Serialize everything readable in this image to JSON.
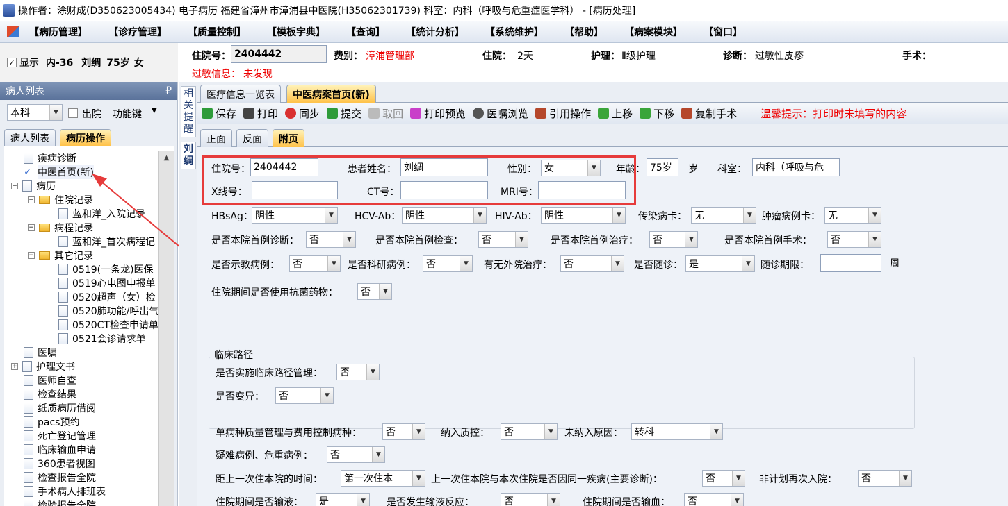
{
  "title": "操作者：涂财成(D350623005434) 电子病历  福建省漳州市漳浦县中医院(H35062301739)  科室：内科（呼吸与危重症医学科） - [病历处理]",
  "menu": [
    "【病历管理】",
    "【诊疗管理】",
    "【质量控制】",
    "【模板字典】",
    "【查询】",
    "【统计分析】",
    "【系统维护】",
    "【帮助】",
    "【病案模块】",
    "【窗口】"
  ],
  "left_info": {
    "show_label": "显示",
    "ward": "内-36",
    "name": "刘绸",
    "age": "75岁",
    "sex": "女"
  },
  "patient": {
    "zyh_label": "住院号：",
    "zyh": "2404442",
    "fb_label": "费别：",
    "fb": "漳浦管理部",
    "zy_label": "住院：",
    "zy": "2天",
    "hl_label": "护理：",
    "hl": "Ⅱ级护理",
    "zd_label": "诊断：",
    "zd": "过敏性皮疹",
    "ss_label": "手术：",
    "allergy_label": "过敏信息：",
    "allergy": "未发现"
  },
  "left_panel": {
    "header": "病人列表",
    "pin": "₽",
    "dept": "本科",
    "discharge": "出院",
    "func": "功能键",
    "tabs": [
      "病人列表",
      "病历操作"
    ],
    "tree": [
      {
        "label": "疾病诊断"
      },
      {
        "label": "中医首页(新)"
      },
      {
        "label": "病历"
      },
      {
        "label": "住院记录"
      },
      {
        "label": "蓝和洋_入院记录"
      },
      {
        "label": "病程记录"
      },
      {
        "label": "蓝和洋_首次病程记"
      },
      {
        "label": "其它记录"
      },
      {
        "label": "0519(一条龙)医保"
      },
      {
        "label": "0519心电图申报单"
      },
      {
        "label": "0520超声（女）检"
      },
      {
        "label": "0520肺功能/呼出气"
      },
      {
        "label": "0520CT检查申请单"
      },
      {
        "label": "0521会诊请求单"
      },
      {
        "label": "医嘱"
      },
      {
        "label": "护理文书"
      },
      {
        "label": "医师自查"
      },
      {
        "label": "检查结果"
      },
      {
        "label": "纸质病历借阅"
      },
      {
        "label": "pacs预约"
      },
      {
        "label": "死亡登记管理"
      },
      {
        "label": "临床输血申请"
      },
      {
        "label": "360患者视图"
      },
      {
        "label": "检查报告全院"
      },
      {
        "label": "手术病人排班表"
      },
      {
        "label": "检验报告全院"
      }
    ]
  },
  "side_strip": {
    "related": "相关提醒",
    "name": "刘绸"
  },
  "doc_tabs": [
    "医疗信息一览表",
    "中医病案首页(新)"
  ],
  "toolbar": {
    "items": [
      "保存",
      "打印",
      "同步",
      "提交",
      "取回",
      "打印预览",
      "医嘱浏览",
      "引用操作",
      "上移",
      "下移",
      "复制手术"
    ],
    "tip": "温馨提示：打印时未填写的内容"
  },
  "page_tabs": [
    "正面",
    "反面",
    "附页"
  ],
  "form": {
    "zyh_label": "住院号：",
    "zyh": "2404442",
    "name_label": "患者姓名：",
    "name": "刘绸",
    "sex_label": "性别：",
    "sex": "女",
    "age_label": "年龄：",
    "age": "75岁",
    "age_unit": "岁",
    "dept_label": "科室：",
    "dept": "内科（呼吸与危",
    "xray_label": "X线号：",
    "ct_label": "CT号：",
    "mri_label": "MRI号：",
    "hbsag_label": "HBsAg：",
    "hbsag": "阴性",
    "hcv_label": "HCV-Ab：",
    "hcv": "阴性",
    "hiv_label": "HIV-Ab：",
    "hiv": "阴性",
    "crb_label": "传染病卡：",
    "crb": "无",
    "zl_label": "肿瘤病例卡：",
    "zl": "无",
    "sczd_label": "是否本院首例诊断：",
    "sczd": "否",
    "scjc_label": "是否本院首例检查：",
    "scjc": "否",
    "sczl_label": "是否本院首例治疗：",
    "sczl": "否",
    "scss_label": "是否本院首例手术：",
    "scss": "否",
    "sj_label": "是否示教病例：",
    "sj": "否",
    "ky_label": "是否科研病例：",
    "ky": "否",
    "ywzl_label": "有无外院治疗：",
    "ywzl": "否",
    "sf_label": "是否随诊：",
    "sf": "是",
    "sfqx_label": "随诊期限：",
    "sfqx_unit": "周",
    "kjyw_label": "住院期间是否使用抗菌药物：",
    "kjyw": "否",
    "lclj_title": "临床路径",
    "lclj_label": "是否实施临床路径管理：",
    "lclj": "否",
    "by_label": "是否变异：",
    "by": "否",
    "dbz_label": "单病种质量管理与费用控制病种：",
    "dbz": "否",
    "nrzk_label": "纳入质控：",
    "nrzk": "否",
    "wnr_label": "未纳入原因：",
    "wnr": "转科",
    "yn_label": "疑难病例、危重病例：",
    "yn": "否",
    "jsy_label": "距上一次住本院的时间：",
    "jsy": "第一次住本",
    "tyjb_label": "上一次住本院与本次住院是否因同一疾病(主要诊断)：",
    "tyjb": "否",
    "fjh_label": "非计划再次入院：",
    "fjh": "否",
    "sy_label": "住院期间是否输液：",
    "sy": "是",
    "syfy_label": "是否发生输液反应：",
    "syfy": "否",
    "sx_label": "住院期间是否输血：",
    "sx": "否"
  },
  "colors": {
    "accent": "#ffc24a",
    "highlight_box": "#e63b3b",
    "arrow": "#e63b3b",
    "warn_text": "#ee0000"
  }
}
